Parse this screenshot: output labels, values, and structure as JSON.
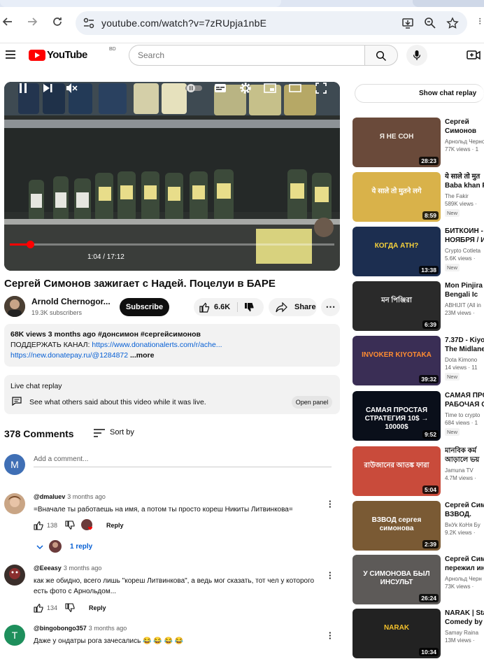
{
  "browser": {
    "url": "youtube.com/watch?v=7zRUpja1nbE",
    "back_icon": "arrow-left-icon",
    "forward_icon": "arrow-right-icon",
    "refresh_icon": "refresh-icon"
  },
  "yt": {
    "logo_text": "YouTube",
    "country": "BD",
    "search_placeholder": "Search"
  },
  "player": {
    "time": "1:04 / 17:12",
    "progress": 0.062
  },
  "video": {
    "title": "Сергей Симонов зажигает с Надей. Поцелуи в БАРЕ",
    "channel": "Arnold Chernogor...",
    "subs": "19.3K subscribers",
    "subscribe": "Subscribe",
    "likes": "6.6K",
    "share": "Share"
  },
  "desc": {
    "meta": "68K views  3 months ago",
    "tags": "#донсимон #сергейсимонов",
    "line2_prefix": "ПОДДЕРЖАТЬ КАНАЛ: ",
    "line2_link": "https://www.donationalerts.com/r/ache...",
    "line3_link": "https://new.donatepay.ru/@1284872",
    "more": "...more"
  },
  "live_chat": {
    "header": "Live chat replay",
    "text": "See what others said about this video while it was live.",
    "button": "Open panel"
  },
  "comments": {
    "count": "378 Comments",
    "sort": "Sort by",
    "my_initial": "M",
    "placeholder": "Add a comment...",
    "items": [
      {
        "author": "@dmaluev",
        "age": "3 months ago",
        "text": "=Вначале ты работаешь на имя, а потом ты просто кореш Никиты Литвинкова=",
        "likes": "138",
        "reply": "Reply",
        "replies": "1 reply"
      },
      {
        "author": "@Eeeasy",
        "age": "3 months ago",
        "text": "как же обидно, всего лишь \"кореш Литвинкова\", а ведь мог сказать, тот чел у которого есть фото с Арнольдом...",
        "likes": "134",
        "reply": "Reply"
      },
      {
        "author": "@bingobongo357",
        "age": "3 months ago",
        "text": "Даже у ондатры рога зачесались 😂 😂 😂 😂",
        "initial": "T"
      }
    ]
  },
  "sidebar": {
    "show_chat": "Show chat replay",
    "recs": [
      {
        "title": "Сергей Симонов устроил жа",
        "channel": "Арнольд Черногор",
        "views": "77K views · 1",
        "duration": "28:23",
        "thumb_text": "Я НЕ СОН"
      },
      {
        "title": "ये साले तो मुत Baba khan R",
        "channel": "The Fakir",
        "views": "589K views ·",
        "duration": "8:59",
        "new": "New",
        "thumb_text": "ये साले तो मुतने लगे"
      },
      {
        "title": "БИТКОИН - НОЯБРЯ / И",
        "channel": "Crypto Cotleta",
        "views": "5.6K views · ",
        "duration": "13:38",
        "new": "New",
        "thumb_text": "КОГДА АТН?"
      },
      {
        "title": "Mon Pinjira | Bengali Ic",
        "channel": "ABHIJIT (All in",
        "views": "23M views ·",
        "duration": "6:39",
        "thumb_text": "মন পিঞ্জিরা"
      },
      {
        "title": "7.37D - Kiyo The Midlane",
        "channel": "Dota Kimono",
        "views": "14 views · 11",
        "duration": "39:32",
        "new": "New",
        "thumb_text": "INVOKER KIYOTAKA"
      },
      {
        "title": "САМАЯ ПРО РАБОЧАЯ С",
        "channel": "Time to crypto",
        "views": "684 views · 1",
        "duration": "9:52",
        "new": "New",
        "thumb_text": "САМАЯ ПРОСТАЯ СТРАТЕГИЯ 10$ → 10000$"
      },
      {
        "title": "মানবিক কর্ম আড়ালে ভয়",
        "channel": "Jamuna TV",
        "views": "4.7M views ·",
        "duration": "5:04",
        "thumb_text": "রাউজানের আতঙ্ক ফারা"
      },
      {
        "title": "Сергей Сим ВЗВОД.",
        "channel": "ВнУк КоНя Бу",
        "views": "9.2K views · ",
        "duration": "2:39",
        "thumb_text": "ВЗВОД сергея симонова"
      },
      {
        "title": "Сергей Сим пережил ин",
        "channel": "Арнольд Черн",
        "views": "73K views ·",
        "duration": "26:24",
        "thumb_text": "У СИМОНОВА БЫЛ ИНСУЛЬТ"
      },
      {
        "title": "NARAK | Sta Comedy by S",
        "channel": "Samay Raina",
        "views": "13M views ·",
        "duration": "10:34",
        "thumb_text": "NARAK"
      }
    ]
  }
}
